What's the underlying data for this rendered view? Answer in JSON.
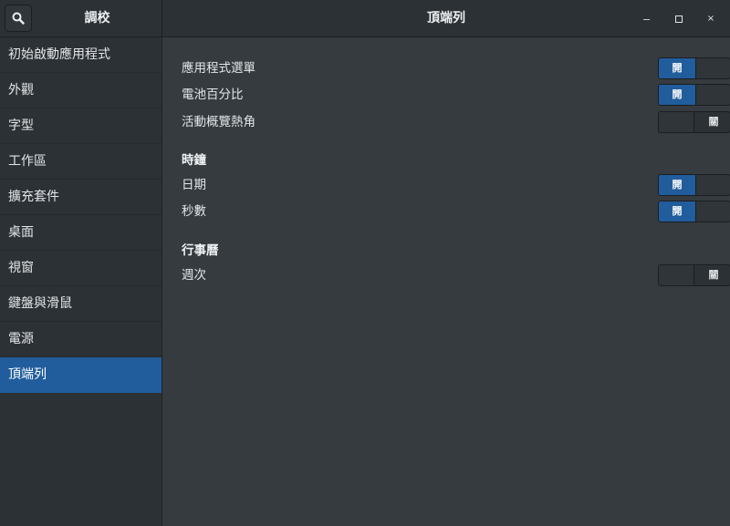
{
  "header": {
    "app_title": "調校",
    "page_title": "頂端列",
    "search_icon": "search-icon",
    "window_controls": {
      "minimize": "–",
      "maximize": "□",
      "close": "×"
    }
  },
  "sidebar": {
    "items": [
      {
        "label": "初始啟動應用程式",
        "selected": false
      },
      {
        "label": "外觀",
        "selected": false
      },
      {
        "label": "字型",
        "selected": false
      },
      {
        "label": "工作區",
        "selected": false
      },
      {
        "label": "擴充套件",
        "selected": false
      },
      {
        "label": "桌面",
        "selected": false
      },
      {
        "label": "視窗",
        "selected": false
      },
      {
        "label": "鍵盤與滑鼠",
        "selected": false
      },
      {
        "label": "電源",
        "selected": false
      },
      {
        "label": "頂端列",
        "selected": true
      }
    ]
  },
  "content": {
    "settings": [
      {
        "label": "應用程式選單",
        "state": "on"
      },
      {
        "label": "電池百分比",
        "state": "on"
      },
      {
        "label": "活動概覽熱角",
        "state": "off"
      }
    ],
    "clock": {
      "title": "時鐘",
      "settings": [
        {
          "label": "日期",
          "state": "on"
        },
        {
          "label": "秒數",
          "state": "on"
        }
      ]
    },
    "calendar": {
      "title": "行事曆",
      "settings": [
        {
          "label": "週次",
          "state": "off"
        }
      ]
    },
    "switch_labels": {
      "on": "開",
      "off": "關"
    }
  },
  "colors": {
    "accent": "#215d9c",
    "background": "#353b3f",
    "sidebar": "#2c3135"
  }
}
